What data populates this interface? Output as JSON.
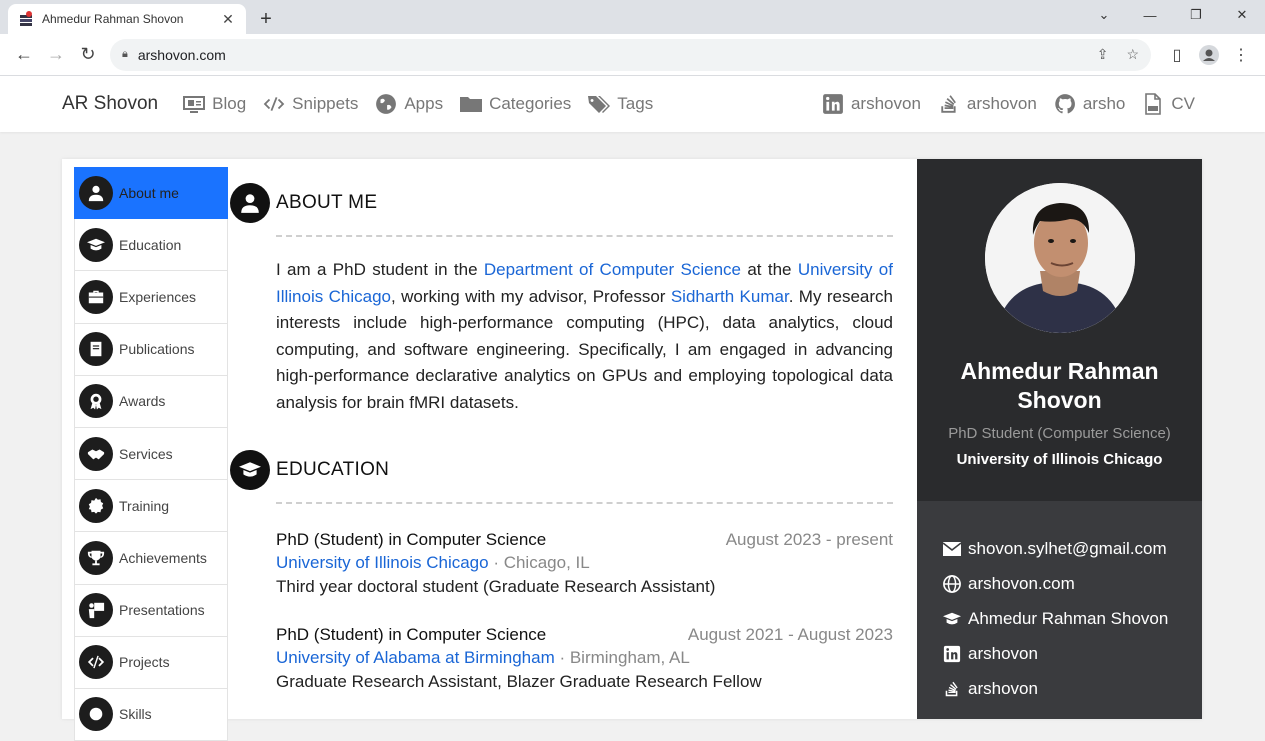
{
  "browser": {
    "tab_title": "Ahmedur Rahman Shovon",
    "url": "arshovon.com"
  },
  "header": {
    "brand": "AR Shovon",
    "nav": [
      {
        "label": "Blog",
        "icon": "blog-icon"
      },
      {
        "label": "Snippets",
        "icon": "code-icon"
      },
      {
        "label": "Apps",
        "icon": "globe-icon"
      },
      {
        "label": "Categories",
        "icon": "folder-icon"
      },
      {
        "label": "Tags",
        "icon": "tags-icon"
      }
    ],
    "social": [
      {
        "label": "arshovon",
        "icon": "linkedin-icon"
      },
      {
        "label": "arshovon",
        "icon": "stackoverflow-icon"
      },
      {
        "label": "arsho",
        "icon": "github-icon"
      },
      {
        "label": "CV",
        "icon": "pdf-icon"
      }
    ]
  },
  "sidebar": {
    "items": [
      {
        "label": "About me",
        "icon": "user-icon",
        "active": true
      },
      {
        "label": "Education",
        "icon": "graduation-cap-icon"
      },
      {
        "label": "Experiences",
        "icon": "briefcase-icon"
      },
      {
        "label": "Publications",
        "icon": "book-icon"
      },
      {
        "label": "Awards",
        "icon": "award-icon"
      },
      {
        "label": "Services",
        "icon": "handshake-icon"
      },
      {
        "label": "Training",
        "icon": "certificate-icon"
      },
      {
        "label": "Achievements",
        "icon": "trophy-icon"
      },
      {
        "label": "Presentations",
        "icon": "presentation-icon"
      },
      {
        "label": "Projects",
        "icon": "code-icon"
      },
      {
        "label": "Skills",
        "icon": "skills-icon"
      }
    ]
  },
  "about": {
    "heading": "ABOUT ME",
    "t1": "I am a PhD student in the ",
    "link_dept": "Department of Computer Science",
    "t2": " at the ",
    "link_univ": "University of Illinois Chicago",
    "t3": ", working with my advisor, Professor ",
    "link_advisor": "Sidharth Kumar",
    "t4": ". My research interests include high-performance computing (HPC), data analytics, cloud computing, and software engineering. Specifically, I am engaged in advancing high-performance declarative analytics on GPUs and employing topological data analysis for brain fMRI datasets."
  },
  "education": {
    "heading": "EDUCATION",
    "entries": [
      {
        "degree": "PhD (Student) in Computer Science",
        "date": "August 2023 - present",
        "university": "University of Illinois Chicago",
        "location": " · Chicago, IL",
        "description": "Third year doctoral student (Graduate Research Assistant)"
      },
      {
        "degree": "PhD (Student) in Computer Science",
        "date": "August 2021 - August 2023",
        "university": "University of Alabama at Birmingham",
        "location": " · Birmingham, AL",
        "description": "Graduate Research Assistant, Blazer Graduate Research Fellow"
      }
    ]
  },
  "profile": {
    "name": "Ahmedur Rahman Shovon",
    "title": "PhD Student (Computer Science)",
    "university": "University of Illinois Chicago",
    "contacts": [
      {
        "label": "shovon.sylhet@gmail.com",
        "icon": "envelope-icon"
      },
      {
        "label": "arshovon.com",
        "icon": "globe-icon"
      },
      {
        "label": "Ahmedur Rahman Shovon",
        "icon": "graduation-cap-icon"
      },
      {
        "label": "arshovon",
        "icon": "linkedin-icon"
      },
      {
        "label": "arshovon",
        "icon": "stackoverflow-icon"
      }
    ]
  }
}
